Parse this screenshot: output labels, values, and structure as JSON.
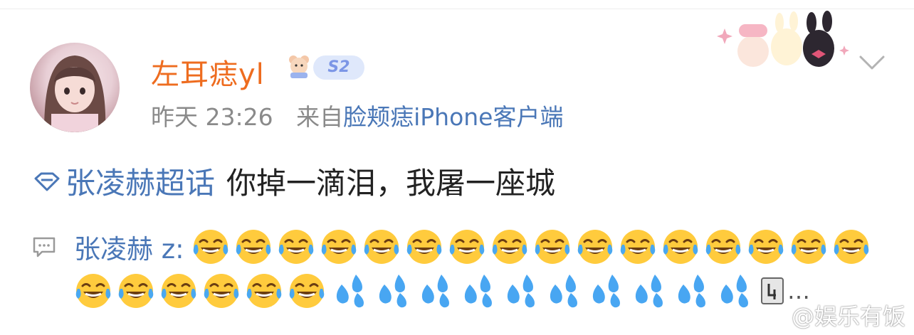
{
  "post": {
    "user": {
      "name": "左耳痣yl",
      "level_badge": "S2"
    },
    "meta": {
      "time": "昨天 23:26",
      "from_prefix": "来自",
      "source": "脸颊痣iPhone客户端"
    },
    "topic": "张凌赫超话",
    "text": "你掉一滴泪，我屠一座城"
  },
  "comment": {
    "author": "张凌赫 z:",
    "emoji_icons_line1": [
      "joy-emoji",
      "joy-emoji",
      "joy-emoji",
      "joy-emoji",
      "joy-emoji",
      "joy-emoji",
      "joy-emoji",
      "joy-emoji",
      "joy-emoji",
      "joy-emoji",
      "joy-emoji",
      "joy-emoji",
      "joy-emoji",
      "joy-emoji",
      "joy-emoji",
      "joy-emoji"
    ],
    "emoji_icons_line2": [
      "joy-emoji",
      "joy-emoji",
      "joy-emoji",
      "joy-emoji",
      "joy-emoji",
      "joy-emoji",
      "sweat-droplets-emoji",
      "sweat-droplets-emoji",
      "sweat-droplets-emoji",
      "sweat-droplets-emoji",
      "sweat-droplets-emoji",
      "sweat-droplets-emoji",
      "sweat-droplets-emoji",
      "sweat-droplets-emoji",
      "sweat-droplets-emoji",
      "sweat-droplets-emoji"
    ],
    "ellipsis": "…"
  },
  "watermark": "@娱乐有饭",
  "colors": {
    "username": "#ee6c1f",
    "link": "#4a77b7",
    "meta": "#8a8a8a"
  }
}
